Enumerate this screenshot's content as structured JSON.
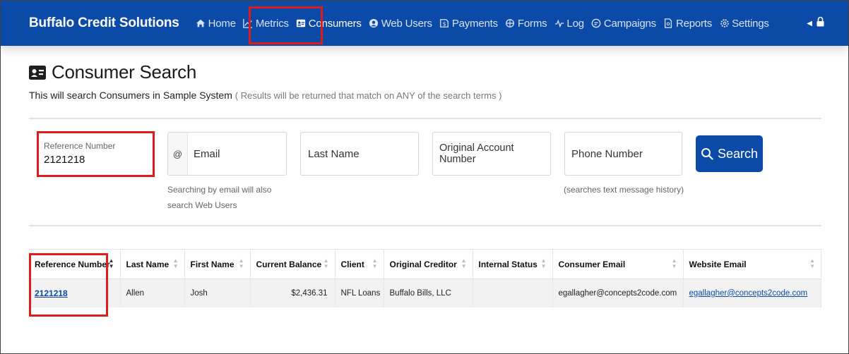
{
  "brand": "Buffalo Credit Solutions",
  "nav": [
    {
      "label": "Home",
      "icon": "home-icon"
    },
    {
      "label": "Metrics",
      "icon": "metrics-icon"
    },
    {
      "label": "Consumers",
      "icon": "consumers-icon"
    },
    {
      "label": "Web Users",
      "icon": "web-users-icon"
    },
    {
      "label": "Payments",
      "icon": "payments-icon"
    },
    {
      "label": "Forms",
      "icon": "forms-icon"
    },
    {
      "label": "Log",
      "icon": "log-icon"
    },
    {
      "label": "Campaigns",
      "icon": "campaigns-icon"
    },
    {
      "label": "Reports",
      "icon": "reports-icon"
    },
    {
      "label": "Settings",
      "icon": "gear-icon"
    }
  ],
  "colors": {
    "primary": "#0b4aa6",
    "highlight": "#e01b1b"
  },
  "page": {
    "title": "Consumer Search",
    "subtitle": "This will search Consumers in Sample System",
    "subtitle_note": "( Results will be returned that match on ANY of the search terms )"
  },
  "search": {
    "reference_label": "Reference Number",
    "reference_value": "2121218",
    "email_prefix": "@",
    "email_placeholder": "Email",
    "email_help_1": "Searching by email will also",
    "email_help_2": "search Web Users",
    "last_name_placeholder": "Last Name",
    "original_account_placeholder": "Original Account Number",
    "phone_placeholder": "Phone Number",
    "phone_help": "(searches text message history)",
    "button_label": "Search"
  },
  "table": {
    "headers": [
      "Reference Number",
      "Last Name",
      "First Name",
      "Current Balance",
      "Client",
      "Original Creditor",
      "Internal Status",
      "Consumer Email",
      "Website Email"
    ],
    "rows": [
      {
        "reference": "2121218",
        "last_name": "Allen",
        "first_name": "Josh",
        "balance": "$2,436.31",
        "client": "NFL Loans",
        "creditor": "Buffalo Bills, LLC",
        "status": "",
        "consumer_email": "egallagher@concepts2code.com",
        "website_email": "egallagher@concepts2code.com"
      }
    ]
  }
}
